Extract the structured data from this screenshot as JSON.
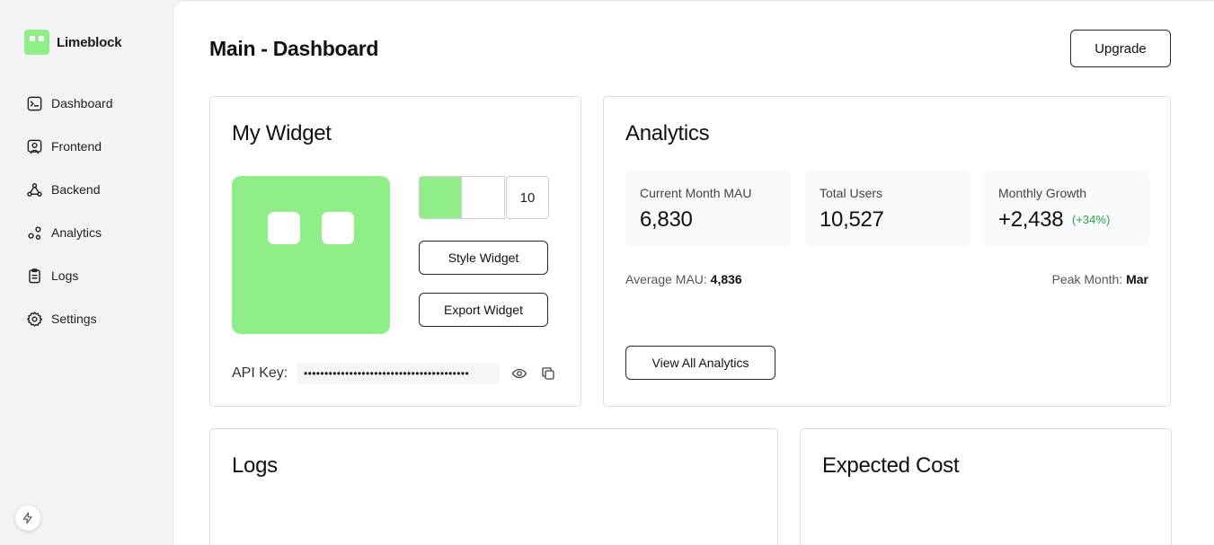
{
  "brand": {
    "name": "Limeblock"
  },
  "sidebar": {
    "items": [
      {
        "label": "Dashboard",
        "icon": "terminal-icon"
      },
      {
        "label": "Frontend",
        "icon": "user-frame-icon"
      },
      {
        "label": "Backend",
        "icon": "network-icon"
      },
      {
        "label": "Analytics",
        "icon": "analytics-icon"
      },
      {
        "label": "Logs",
        "icon": "clipboard-icon"
      },
      {
        "label": "Settings",
        "icon": "gear-icon"
      }
    ]
  },
  "header": {
    "title": "Main - Dashboard",
    "upgrade_label": "Upgrade"
  },
  "widget": {
    "title": "My Widget",
    "color": "#90ee88",
    "secondary_color": "#ffffff",
    "size_value": "10",
    "style_label": "Style Widget",
    "export_label": "Export Widget",
    "api_key_label": "API Key:",
    "api_key_masked": "••••••••••••••••••••••••••••••••••••••••"
  },
  "analytics": {
    "title": "Analytics",
    "stats": [
      {
        "label": "Current Month MAU",
        "value": "6,830"
      },
      {
        "label": "Total Users",
        "value": "10,527"
      },
      {
        "label": "Monthly Growth",
        "value": "+2,438",
        "delta": "(+34%)"
      }
    ],
    "average_label": "Average MAU:",
    "average_value": "4,836",
    "peak_label": "Peak Month:",
    "peak_value": "Mar",
    "view_all_label": "View All Analytics"
  },
  "logs": {
    "title": "Logs"
  },
  "cost": {
    "title": "Expected Cost"
  }
}
